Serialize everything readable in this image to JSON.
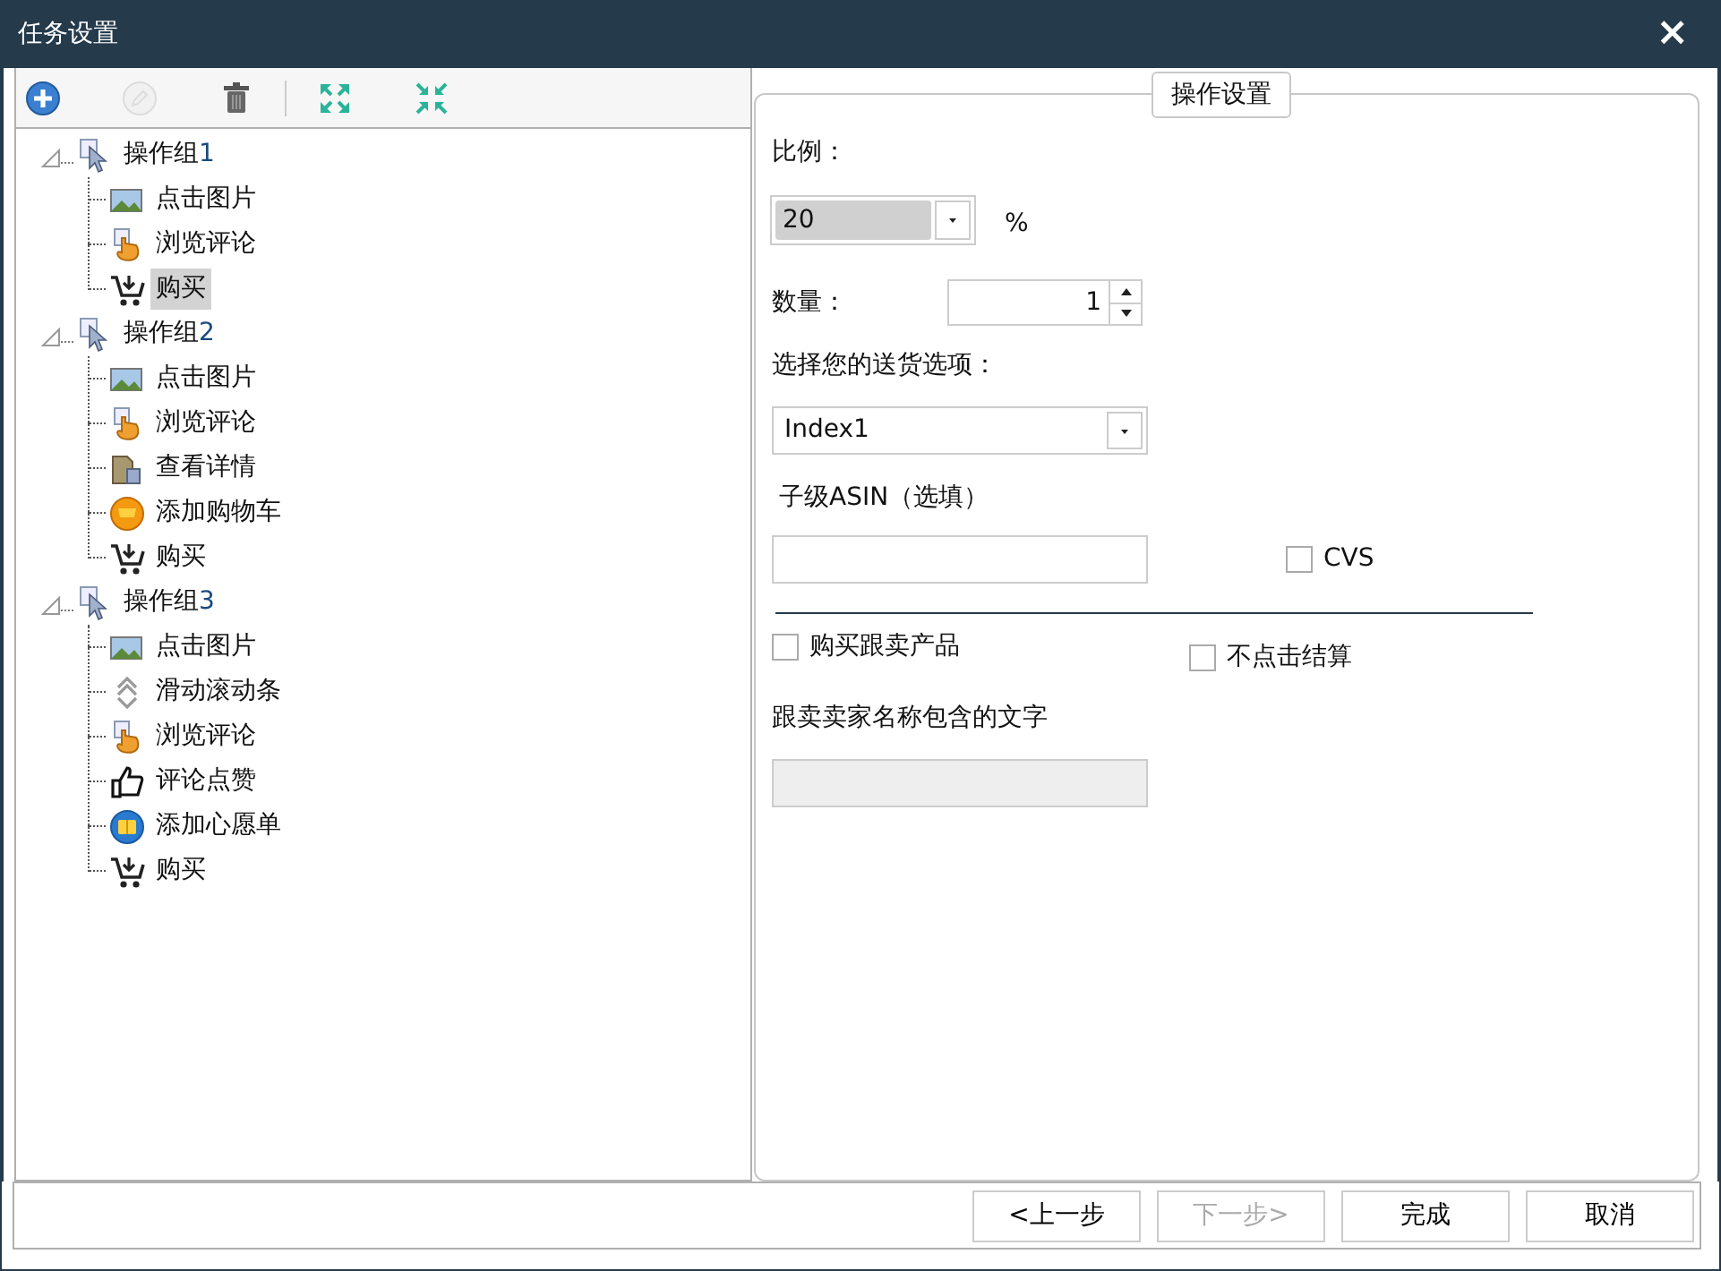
{
  "window": {
    "title": "任务设置",
    "close": "×"
  },
  "toolbar": [
    {
      "kind": "add",
      "disabled": false
    },
    {
      "kind": "edit",
      "disabled": true
    },
    {
      "kind": "delete",
      "disabled": false
    },
    {
      "kind": "expand",
      "disabled": false
    },
    {
      "kind": "collapse",
      "disabled": false
    }
  ],
  "tree": [
    {
      "label": "操作组",
      "number": "1",
      "kind": "pointer",
      "expanded": true,
      "selected": false,
      "children": [
        {
          "label": "点击图片",
          "kind": "picture",
          "selected": false
        },
        {
          "label": "浏览评论",
          "kind": "hand",
          "selected": false
        },
        {
          "label": "购买",
          "kind": "cart",
          "selected": true
        }
      ]
    },
    {
      "label": "操作组",
      "number": "2",
      "kind": "pointer",
      "expanded": true,
      "selected": false,
      "children": [
        {
          "label": "点击图片",
          "kind": "picture",
          "selected": false
        },
        {
          "label": "浏览评论",
          "kind": "hand",
          "selected": false
        },
        {
          "label": "查看详情",
          "kind": "folder",
          "selected": false
        },
        {
          "label": "添加购物车",
          "kind": "cartcoin",
          "selected": false
        },
        {
          "label": "购买",
          "kind": "cart",
          "selected": false
        }
      ]
    },
    {
      "label": "操作组",
      "number": "3",
      "kind": "pointer",
      "expanded": true,
      "selected": false,
      "children": [
        {
          "label": "点击图片",
          "kind": "picture",
          "selected": false
        },
        {
          "label": "滑动滚动条",
          "kind": "scroll",
          "selected": false
        },
        {
          "label": "浏览评论",
          "kind": "hand",
          "selected": false
        },
        {
          "label": "评论点赞",
          "kind": "thumb",
          "selected": false
        },
        {
          "label": "添加心愿单",
          "kind": "wish",
          "selected": false
        },
        {
          "label": "购买",
          "kind": "cart",
          "selected": false
        }
      ]
    }
  ],
  "settings": {
    "legend": "操作设置",
    "ratio": {
      "label": "比例：",
      "value": "20",
      "unit": "%"
    },
    "quantity": {
      "label": "数量：",
      "value": "1"
    },
    "shipping": {
      "label": "选择您的送货选项：",
      "value": "Index1"
    },
    "asin": {
      "label": "子级ASIN（选填）",
      "cvs": {
        "label": "CVS",
        "checked": false
      }
    },
    "buy_follow": {
      "label": "购买跟卖产品",
      "checked": false
    },
    "no_checkout": {
      "label": "不点击结算",
      "checked": false
    },
    "seller_text": {
      "label": "跟卖卖家名称包含的文字",
      "disabled": true
    }
  },
  "buttons": [
    {
      "label": "<上一步",
      "disabled": false
    },
    {
      "label": "下一步>",
      "disabled": true
    },
    {
      "label": "完成",
      "disabled": false
    },
    {
      "label": "取消",
      "disabled": false
    }
  ]
}
